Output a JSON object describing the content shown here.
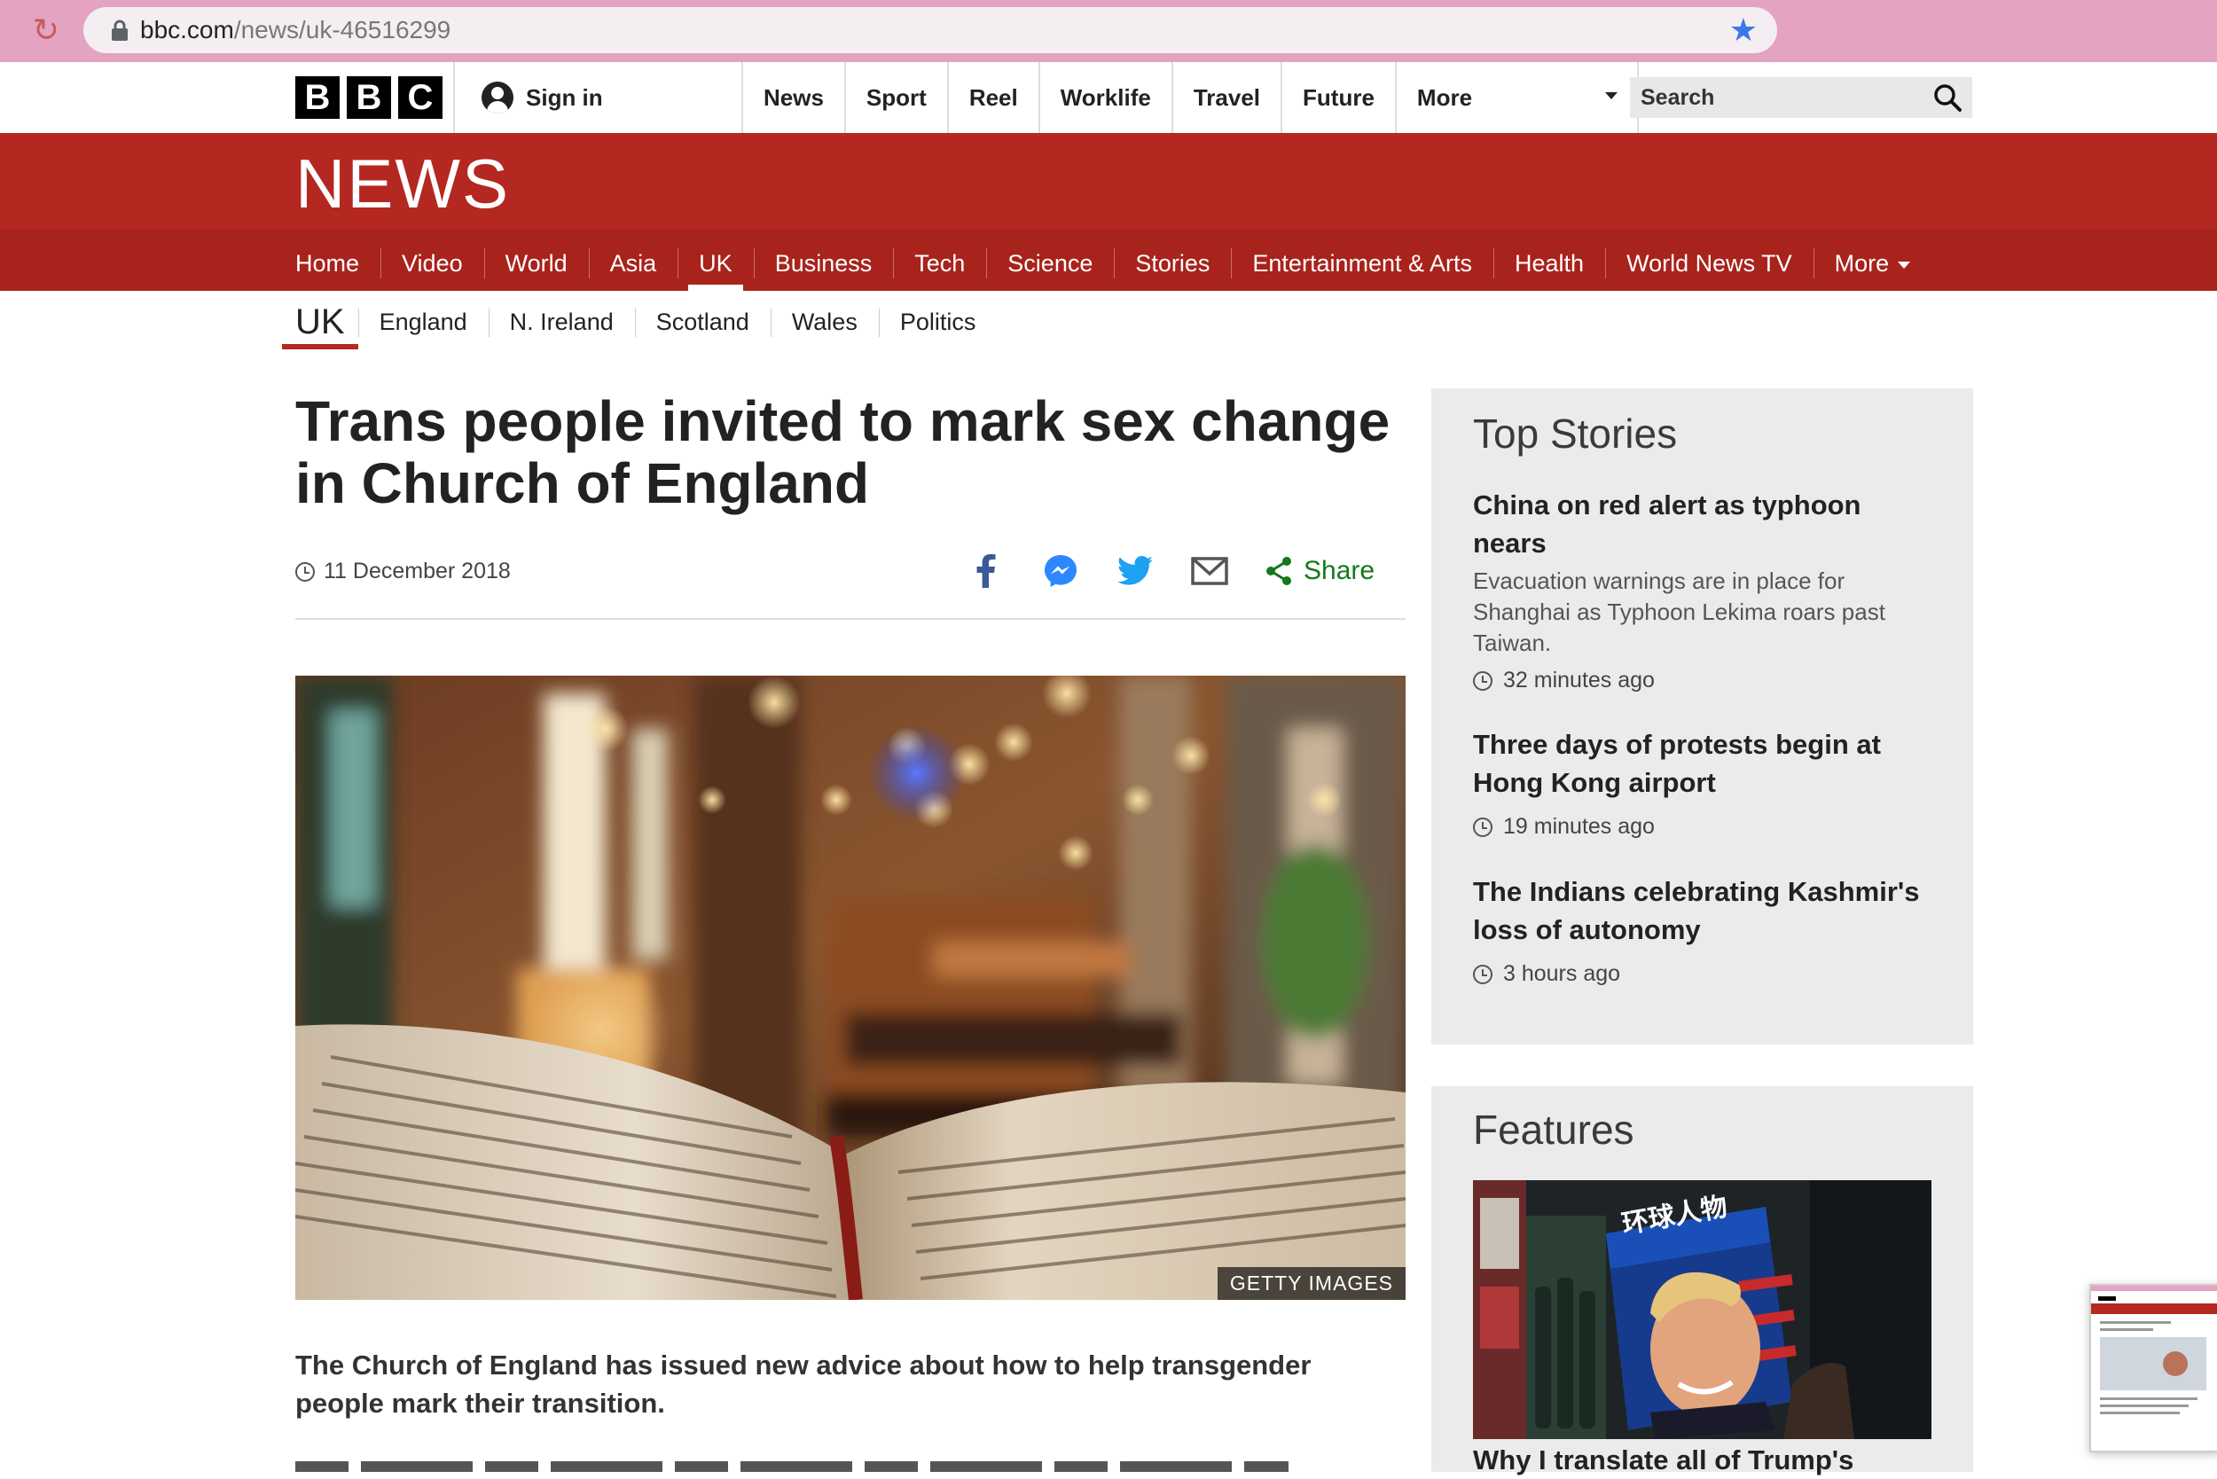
{
  "browser": {
    "url_domain": "bbc.com",
    "url_path": "/news/uk-46516299",
    "reload_icon": "reload-icon",
    "bookmark_icon": "star-icon"
  },
  "bbc_header": {
    "logo_letters": [
      "B",
      "B",
      "C"
    ],
    "sign_in": "Sign in",
    "nav": [
      "News",
      "Sport",
      "Reel",
      "Worklife",
      "Travel",
      "Future"
    ],
    "more": "More",
    "search_placeholder": "Search"
  },
  "news_banner": {
    "logo": "NEWS",
    "nav": [
      {
        "label": "Home",
        "active": false
      },
      {
        "label": "Video",
        "active": false
      },
      {
        "label": "World",
        "active": false
      },
      {
        "label": "Asia",
        "active": false
      },
      {
        "label": "UK",
        "active": true
      },
      {
        "label": "Business",
        "active": false
      },
      {
        "label": "Tech",
        "active": false
      },
      {
        "label": "Science",
        "active": false
      },
      {
        "label": "Stories",
        "active": false
      },
      {
        "label": "Entertainment & Arts",
        "active": false
      },
      {
        "label": "Health",
        "active": false
      },
      {
        "label": "World News TV",
        "active": false
      }
    ],
    "more": "More"
  },
  "subnav": {
    "current": "UK",
    "items": [
      "England",
      "N. Ireland",
      "Scotland",
      "Wales",
      "Politics"
    ]
  },
  "article": {
    "headline_line1": "Trans people invited to mark sex change",
    "headline_line2": "in Church of England",
    "date": "11 December 2018",
    "share_label": "Share",
    "image_credit": "GETTY IMAGES",
    "intro": "The Church of England has issued new advice about how to help transgender people mark their transition."
  },
  "colors": {
    "bbc_red": "#b42821",
    "share_green": "#127a1b",
    "facebook": "#3b5998",
    "messenger": "#2d88ff",
    "twitter": "#1da1f2"
  },
  "sidebar": {
    "top_stories_title": "Top Stories",
    "stories": [
      {
        "title": "China on red alert as typhoon nears",
        "summary": "Evacuation warnings are in place for Shanghai as Typhoon Lekima roars past Taiwan.",
        "time": "32 minutes ago"
      },
      {
        "title": "Three days of protests begin at Hong Kong airport",
        "summary": "",
        "time": "19 minutes ago"
      },
      {
        "title": "The Indians celebrating Kashmir's loss of autonomy",
        "summary": "",
        "time": "3 hours ago"
      }
    ],
    "features_title": "Features",
    "feature_title": "Why I translate all of Trump's",
    "feature_magazine_text": "环球人物"
  }
}
